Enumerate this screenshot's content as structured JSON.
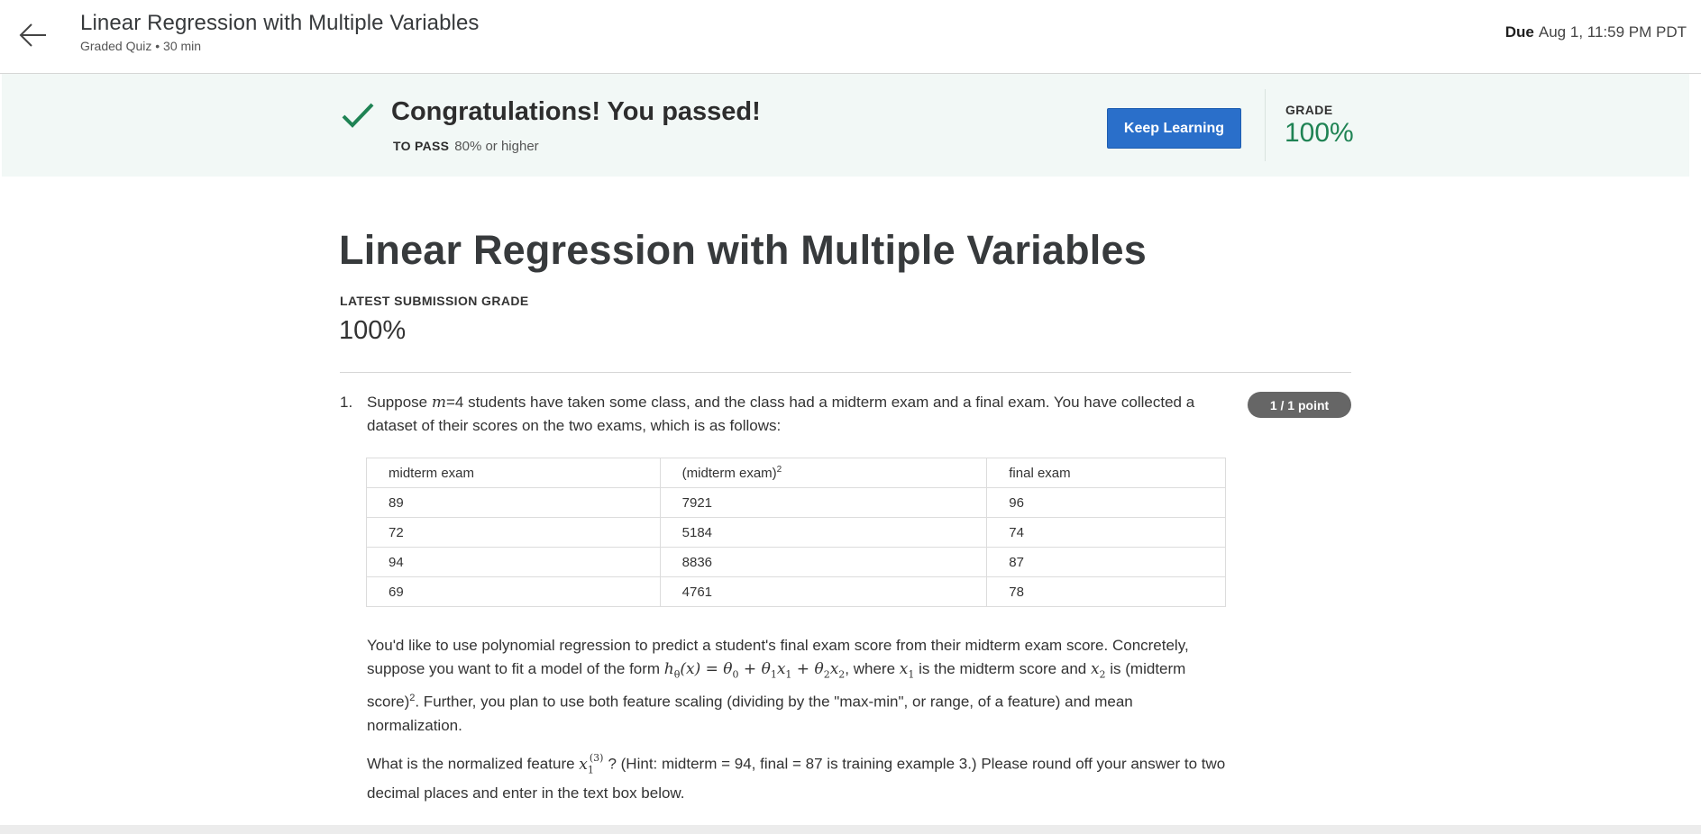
{
  "header": {
    "title": "Linear Regression with Multiple Variables",
    "subtitle": "Graded Quiz • 30 min",
    "due_label": "Due",
    "due_value": "Aug 1, 11:59 PM PDT"
  },
  "banner": {
    "message": "Congratulations! You passed!",
    "to_pass_label": "TO PASS",
    "to_pass_value": "80% or higher",
    "button_label": "Keep Learning",
    "grade_label": "GRADE",
    "grade_value": "100%"
  },
  "main": {
    "title": "Linear Regression with Multiple Variables",
    "latest_label": "LATEST SUBMISSION GRADE",
    "latest_value": "100%"
  },
  "question": {
    "number": "1.",
    "points": "1 / 1 point",
    "intro_a": "Suppose ",
    "intro_m": "m",
    "intro_b": "=4 students have taken some class, and the class had a midterm exam and a final exam. You have collected a dataset of their scores on the two exams, which is as follows:",
    "table": {
      "headers": [
        "midterm exam",
        "(midterm exam)",
        "final exam"
      ],
      "header_sup": "2",
      "rows": [
        [
          "89",
          "7921",
          "96"
        ],
        [
          "72",
          "5184",
          "74"
        ],
        [
          "94",
          "8836",
          "87"
        ],
        [
          "69",
          "4761",
          "78"
        ]
      ]
    },
    "para1_a": "You'd like to use polynomial regression to predict a student's final exam score from their midterm exam score. Concretely, suppose you want to fit a model of the form ",
    "para1_b": ", where ",
    "para1_c": " is the midterm score and ",
    "para1_d": " is (midterm score)",
    "para1_e": ". Further, you plan to use both feature scaling (dividing by the \"max-min\", or range, of a feature) and mean normalization.",
    "para2_a": "What is the normalized feature ",
    "para2_b": "? (Hint: midterm = 94, final = 87 is training example 3.) Please round off your answer to two decimal places and enter in the text box below."
  }
}
